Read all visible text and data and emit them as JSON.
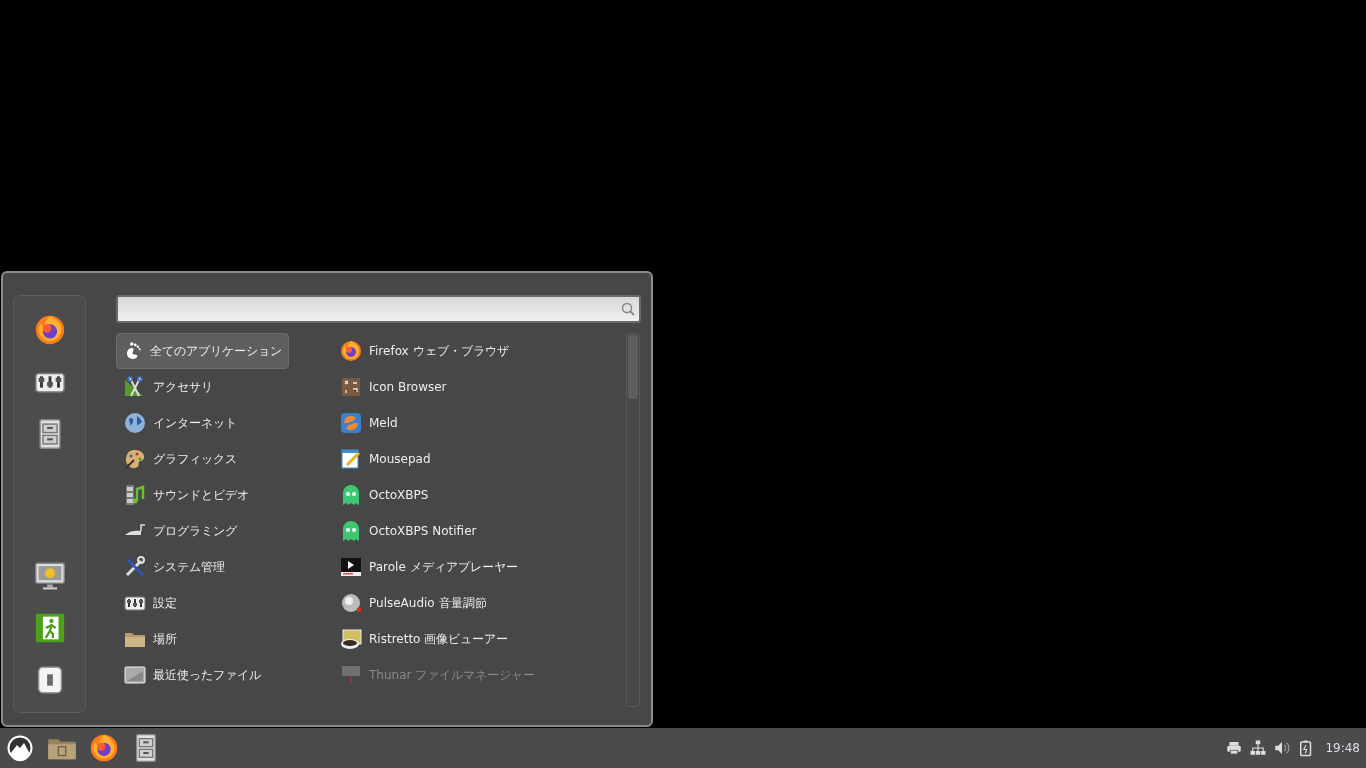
{
  "categories": [
    {
      "label": "全てのアプリケーション",
      "selected": true
    },
    {
      "label": "アクセサリ",
      "selected": false
    },
    {
      "label": "インターネット",
      "selected": false
    },
    {
      "label": "グラフィックス",
      "selected": false
    },
    {
      "label": "サウンドとビデオ",
      "selected": false
    },
    {
      "label": "プログラミング",
      "selected": false
    },
    {
      "label": "システム管理",
      "selected": false
    },
    {
      "label": "設定",
      "selected": false
    },
    {
      "label": "場所",
      "selected": false
    },
    {
      "label": "最近使ったファイル",
      "selected": false
    }
  ],
  "apps": [
    {
      "label": "Firefox ウェブ・ブラウザ",
      "dimmed": false
    },
    {
      "label": "Icon Browser",
      "dimmed": false
    },
    {
      "label": "Meld",
      "dimmed": false
    },
    {
      "label": "Mousepad",
      "dimmed": false
    },
    {
      "label": "OctoXBPS",
      "dimmed": false
    },
    {
      "label": "OctoXBPS Notifier",
      "dimmed": false
    },
    {
      "label": "Parole メディアプレーヤー",
      "dimmed": false
    },
    {
      "label": "PulseAudio 音量調節",
      "dimmed": false
    },
    {
      "label": "Ristretto 画像ビューアー",
      "dimmed": false
    },
    {
      "label": "Thunar ファイルマネージャー",
      "dimmed": true
    }
  ],
  "taskbar": {
    "clock": "19:48"
  }
}
